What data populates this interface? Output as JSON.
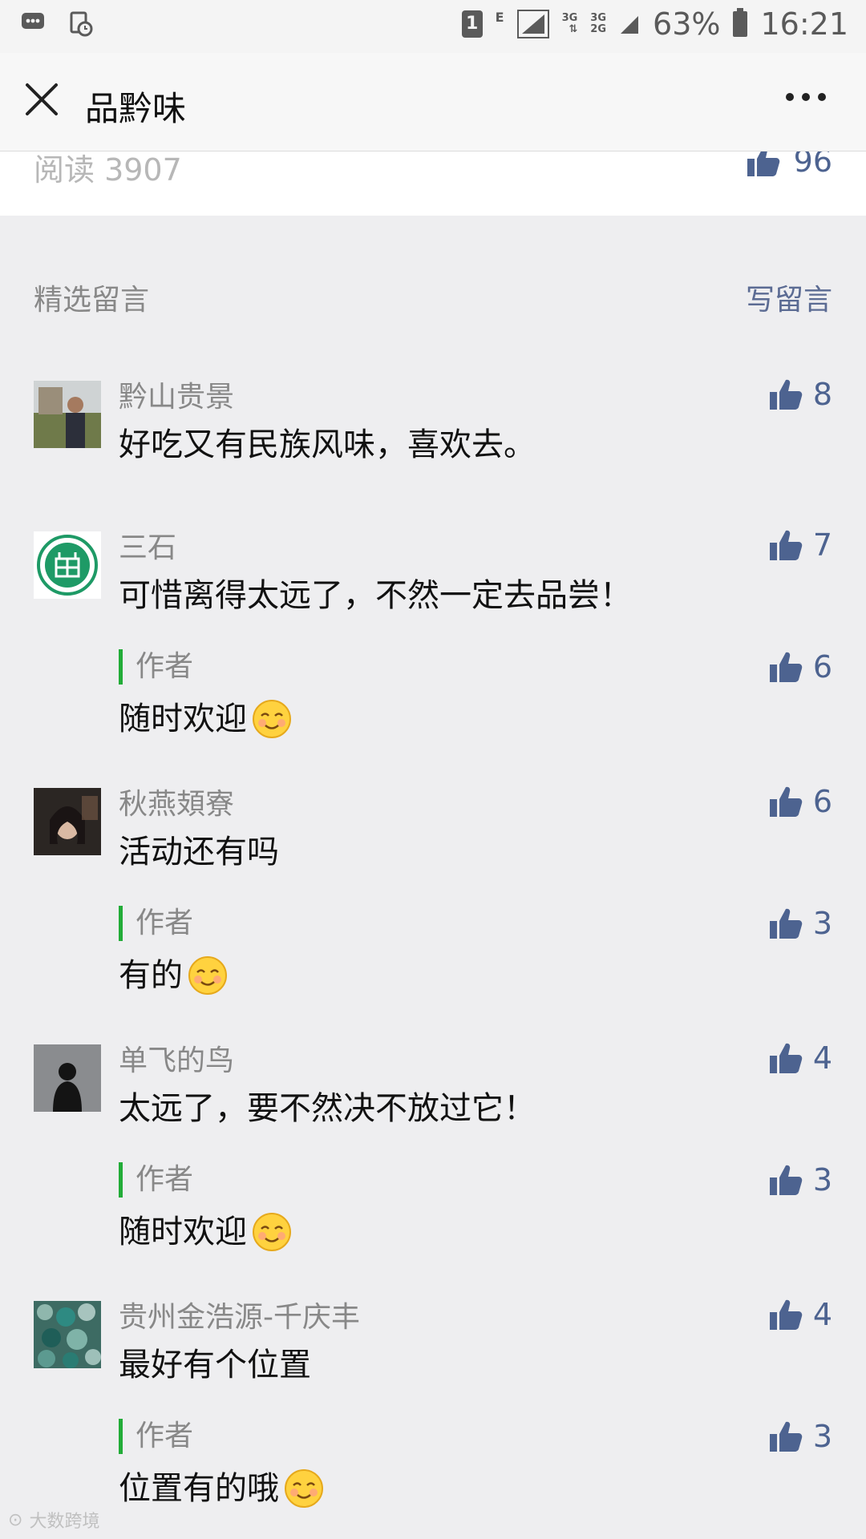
{
  "status_bar": {
    "sim_slot": "1",
    "network_e": "E",
    "network_3g_a": "3G",
    "network_3g_b": "3G",
    "network_2g": "2G",
    "battery": "63%",
    "time": "16:21"
  },
  "header": {
    "title": "品黔味"
  },
  "article": {
    "read_count": "阅读 3907",
    "like_count": "96"
  },
  "comments_section": {
    "title": "精选留言",
    "write_label": "写留言"
  },
  "comments": [
    {
      "name": "黔山贵景",
      "text": "好吃又有民族风味，喜欢去。",
      "likes": "8",
      "reply": null
    },
    {
      "name": "三石",
      "text": "可惜离得太远了，不然一定去品尝！",
      "likes": "7",
      "reply": {
        "label": "作者",
        "text": "随时欢迎",
        "likes": "6"
      }
    },
    {
      "name": "秋燕頍寮",
      "text": "活动还有吗",
      "likes": "6",
      "reply": {
        "label": "作者",
        "text": "有的",
        "likes": "3"
      }
    },
    {
      "name": "单飞的鸟",
      "text": "太远了，要不然决不放过它！",
      "likes": "4",
      "reply": {
        "label": "作者",
        "text": "随时欢迎",
        "likes": "3"
      }
    },
    {
      "name": "贵州金浩源-千庆丰",
      "text": "最好有个位置",
      "likes": "4",
      "reply": {
        "label": "作者",
        "text": "位置有的哦",
        "likes": "3"
      }
    }
  ],
  "watermark": "大数跨境",
  "colors": {
    "accent_green": "#22ac38",
    "link_blue": "#4d6390"
  },
  "icons": [
    "close-icon",
    "more-icon",
    "thumb-up-icon",
    "smile-emoji-icon",
    "signal-icon",
    "battery-icon"
  ]
}
